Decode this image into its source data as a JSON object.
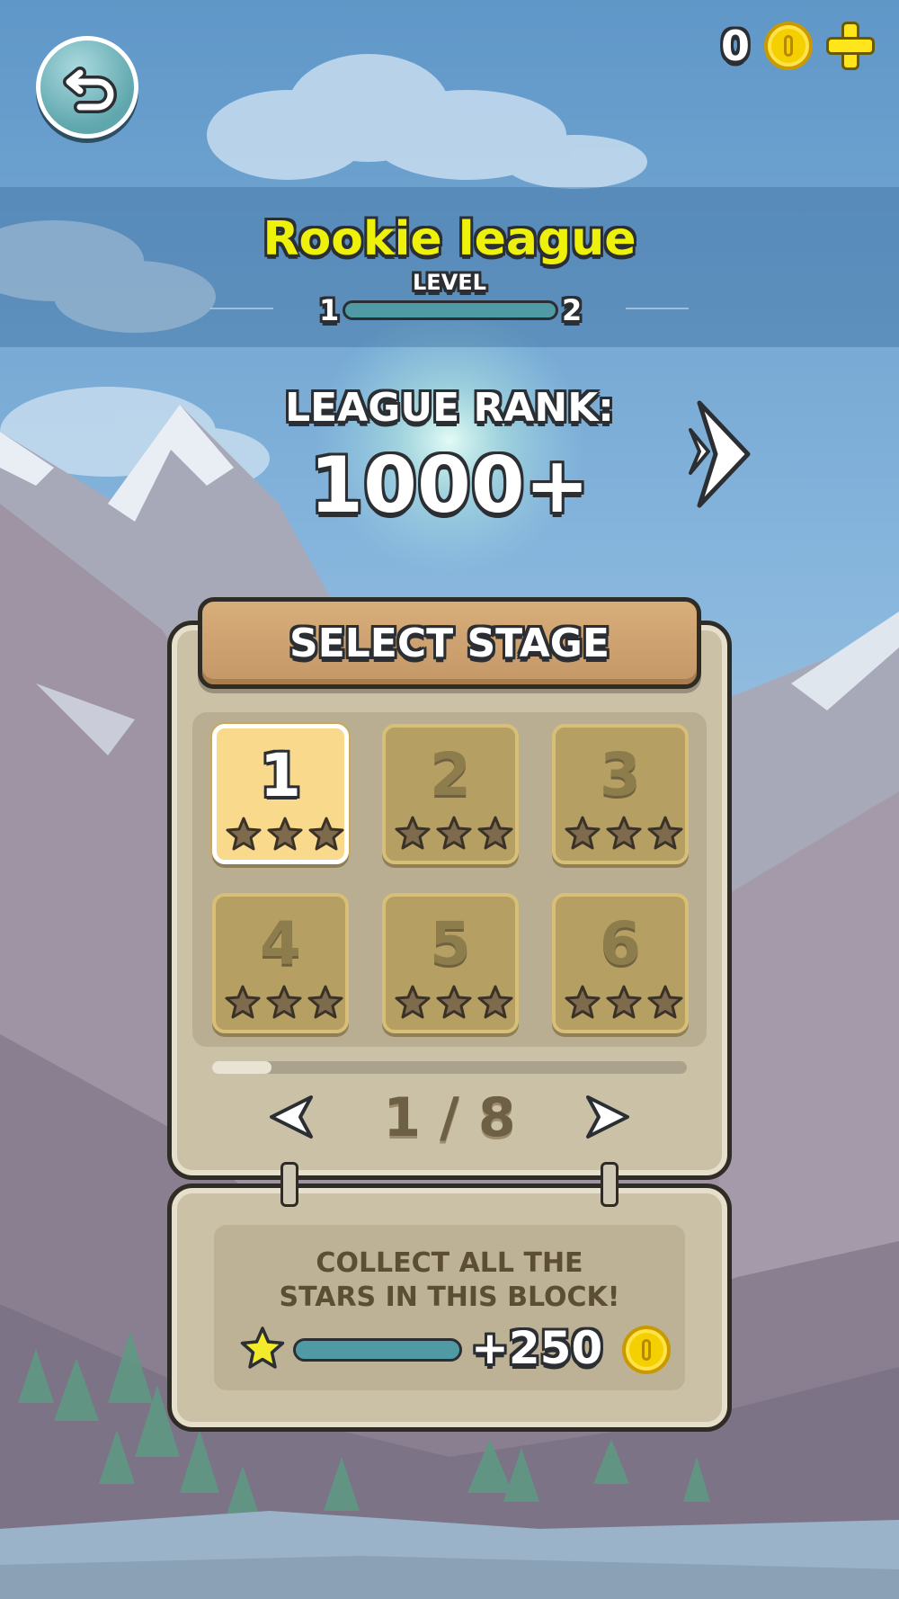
{
  "header": {
    "coins": "0",
    "back_icon": "back-arrow-icon",
    "coin_icon": "coin-icon",
    "add_icon": "plus-icon"
  },
  "league": {
    "title": "Rookie league",
    "level_label": "LEVEL",
    "level_current": "1",
    "level_next": "2",
    "level_progress": 0
  },
  "rank": {
    "label": "LEAGUE RANK:",
    "value": "1000+",
    "next_icon": "chevron-right-icon"
  },
  "stage_select": {
    "title": "SELECT STAGE",
    "stages": [
      {
        "number": "1",
        "stars": 0,
        "selected": true
      },
      {
        "number": "2",
        "stars": 0,
        "selected": false
      },
      {
        "number": "3",
        "stars": 0,
        "selected": false
      },
      {
        "number": "4",
        "stars": 0,
        "selected": false
      },
      {
        "number": "5",
        "stars": 0,
        "selected": false
      },
      {
        "number": "6",
        "stars": 0,
        "selected": false
      }
    ],
    "page": "1 / 8",
    "page_current": 1,
    "page_total": 8
  },
  "reward": {
    "line1": "COLLECT ALL THE",
    "line2": "STARS IN THIS BLOCK!",
    "amount": "+250",
    "progress": 0,
    "star_icon": "star-icon",
    "coin_icon": "coin-icon"
  },
  "colors": {
    "league_title": "#eef20a",
    "coin": "#f4d000",
    "progress": "#4f9aa4",
    "panel": "#cbc1a6",
    "header_wood": "#d8ae7a"
  }
}
